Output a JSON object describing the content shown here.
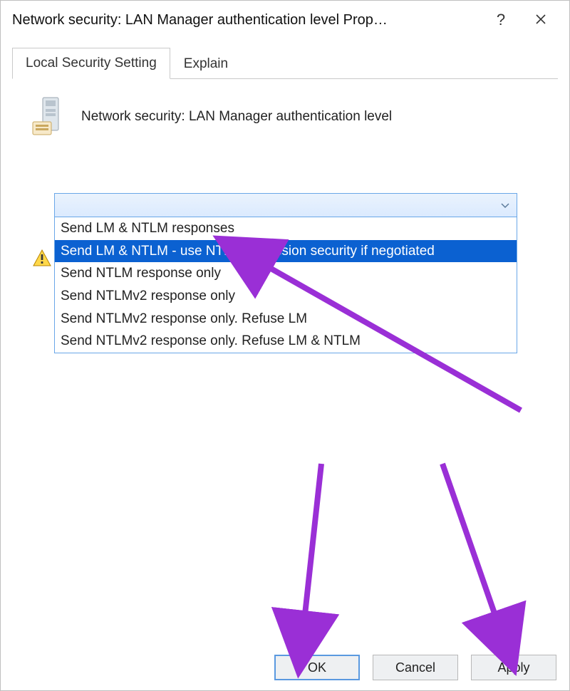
{
  "titlebar": {
    "title": "Network security: LAN Manager authentication level Prop…"
  },
  "tabs": {
    "local_security_setting": "Local Security Setting",
    "explain": "Explain"
  },
  "policy": {
    "label": "Network security: LAN Manager authentication level"
  },
  "dropdown": {
    "options": [
      "Send LM & NTLM responses",
      "Send LM & NTLM - use NTLMv2 session security if negotiated",
      "Send NTLM response only",
      "Send NTLMv2 response only",
      "Send NTLMv2 response only. Refuse LM",
      "Send NTLMv2 response only. Refuse LM & NTLM"
    ],
    "selected_index": 1
  },
  "buttons": {
    "ok": "OK",
    "cancel": "Cancel",
    "apply": "Apply"
  },
  "colors": {
    "selection_bg": "#0b61d1",
    "accent_border": "#6aa7e8",
    "annotation": "#9a2fd6"
  }
}
